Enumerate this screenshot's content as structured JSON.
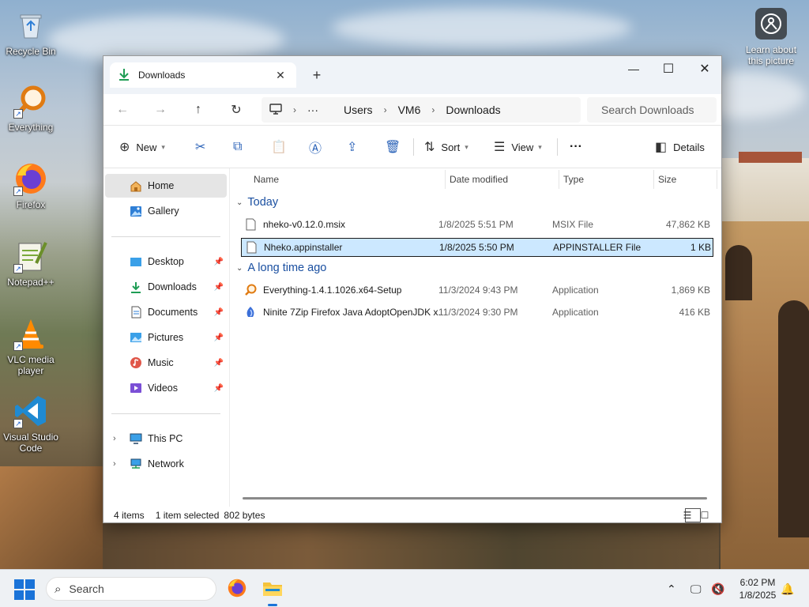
{
  "desktop": {
    "icons": [
      {
        "label": "Recycle Bin"
      },
      {
        "label": "Everything"
      },
      {
        "label": "Firefox"
      },
      {
        "label": "Notepad++"
      },
      {
        "label": "VLC media player"
      },
      {
        "label": "Visual Studio Code"
      }
    ],
    "learn_label": "Learn about this picture"
  },
  "window": {
    "tab_title": "Downloads",
    "controls": {
      "minimize": "—",
      "maximize": "☐",
      "close": "✕"
    },
    "breadcrumb": [
      "Users",
      "VM6",
      "Downloads"
    ],
    "breadcrumb_more": "···",
    "search_placeholder": "Search Downloads"
  },
  "toolbar": {
    "new_label": "New",
    "sort_label": "Sort",
    "view_label": "View",
    "more_label": "···",
    "details_label": "Details"
  },
  "sidebar": {
    "home": "Home",
    "gallery": "Gallery",
    "quick": [
      "Desktop",
      "Downloads",
      "Documents",
      "Pictures",
      "Music",
      "Videos"
    ],
    "this_pc": "This PC",
    "network": "Network"
  },
  "columns": {
    "name": "Name",
    "date": "Date modified",
    "type": "Type",
    "size": "Size"
  },
  "groups": {
    "today": "Today",
    "older": "A long time ago"
  },
  "files": [
    {
      "name": "nheko-v0.12.0.msix",
      "date": "1/8/2025 5:51 PM",
      "type": "MSIX File",
      "size": "47,862 KB"
    },
    {
      "name": "Nheko.appinstaller",
      "date": "1/8/2025 5:50 PM",
      "type": "APPINSTALLER File",
      "size": "1 KB"
    },
    {
      "name": "Everything-1.4.1.1026.x64-Setup",
      "date": "11/3/2024 9:43 PM",
      "type": "Application",
      "size": "1,869 KB"
    },
    {
      "name": "Ninite 7Zip Firefox Java AdoptOpenJDK x...",
      "date": "11/3/2024 9:30 PM",
      "type": "Application",
      "size": "416 KB"
    }
  ],
  "status": {
    "items": "4 items",
    "selected": "1 item selected",
    "bytes": "802 bytes"
  },
  "taskbar": {
    "search_label": "Search",
    "time": "6:02 PM",
    "date": "1/8/2025"
  },
  "colors": {
    "accent": "#1a73d8",
    "selection": "#cce8ff",
    "group_header": "#1a4fa0"
  }
}
